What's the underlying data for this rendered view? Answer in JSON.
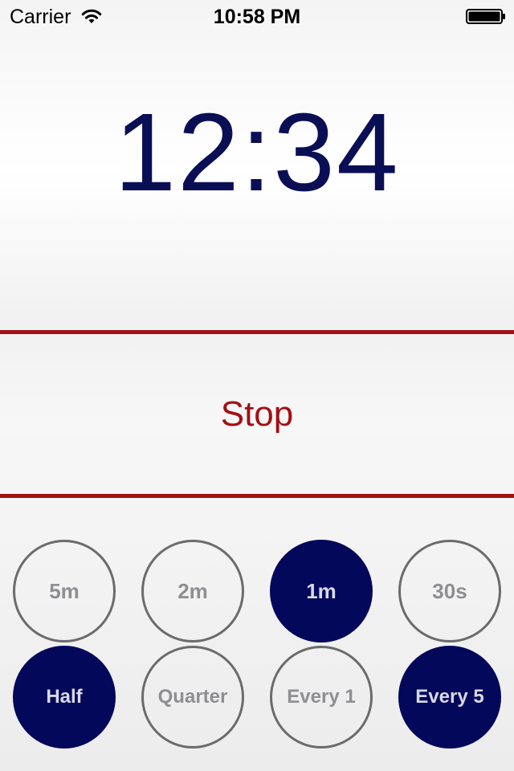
{
  "status_bar": {
    "carrier": "Carrier",
    "time": "10:58 PM",
    "wifi_icon": "wifi-icon",
    "battery_icon": "battery-icon"
  },
  "clock": {
    "time": "12:34",
    "color": "#0a0f55"
  },
  "stop_button": {
    "label": "Stop",
    "color": "#a30f14"
  },
  "intervals": [
    {
      "label": "5m",
      "selected": false
    },
    {
      "label": "2m",
      "selected": false
    },
    {
      "label": "1m",
      "selected": true
    },
    {
      "label": "30s",
      "selected": false
    },
    {
      "label": "Half",
      "selected": true
    },
    {
      "label": "Quarter",
      "selected": false
    },
    {
      "label": "Every 1",
      "selected": false
    },
    {
      "label": "Every 5",
      "selected": true
    }
  ],
  "colors": {
    "selected_fill": "#04085a",
    "accent_red": "#a30f14",
    "unselected_border": "#6b6b6b"
  }
}
